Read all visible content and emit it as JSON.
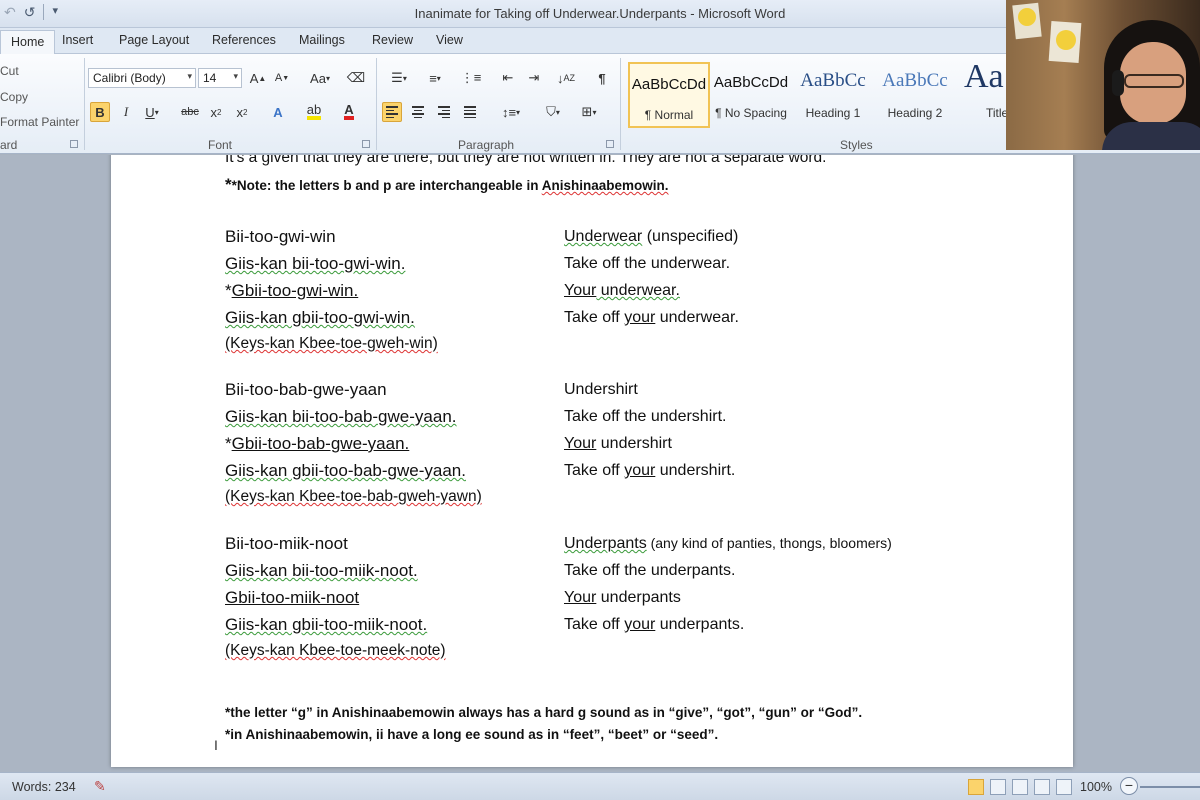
{
  "window": {
    "title": "Inanimate for Taking off Underwear.Underpants  -  Microsoft Word"
  },
  "tabs": [
    "Home",
    "Insert",
    "Page Layout",
    "References",
    "Mailings",
    "Review",
    "View"
  ],
  "ribbon": {
    "clipboard": {
      "items": [
        "Cut",
        "Copy",
        "Format Painter"
      ],
      "label": "ard"
    },
    "font": {
      "label": "Font",
      "font_name": "Calibri (Body)",
      "font_size": "14"
    },
    "paragraph": {
      "label": "Paragraph"
    },
    "styles": {
      "label": "Styles",
      "tiles": [
        {
          "sample": "AaBbCcDd",
          "name": "¶ Normal"
        },
        {
          "sample": "AaBbCcDd",
          "name": "¶ No Spacing"
        },
        {
          "sample": "AaBbCc",
          "name": "Heading 1"
        },
        {
          "sample": "AaBbCc",
          "name": "Heading 2"
        },
        {
          "sample": "Aa",
          "name": "Title"
        }
      ]
    }
  },
  "document": {
    "top_line": "It's a given that they are there, but they are not written in.  They are not a separate word.",
    "note_prefix": "*Note: the letters  b and p are interchangeable  in ",
    "note_word": "Anishinaabemowin.",
    "blocks": [
      {
        "rows": [
          {
            "left": "Bii-too-gwi-win",
            "right_u": "Underwear",
            "right_rest": "  (unspecified)"
          },
          {
            "left": "Giis-kan bii-too-gwi-win.",
            "right": "Take off the underwear."
          },
          {
            "left_star": "*",
            "left": "Gbii-too-gwi-win.",
            "right_u": "Your",
            "right_rest": " underwear."
          },
          {
            "left": "Giis-kan gbii-too-gwi-win.",
            "right_pre": "Take off ",
            "right_u": "your",
            "right_rest": " underwear."
          }
        ],
        "pronunciation": "(Keys-kan Kbee-toe-gweh-win)"
      },
      {
        "rows": [
          {
            "left": "Bii-too-bab-gwe-yaan",
            "right": "Undershirt"
          },
          {
            "left": "Giis-kan bii-too-bab-gwe-yaan.",
            "right": "Take off the undershirt."
          },
          {
            "left_star": "*",
            "left": "Gbii-too-bab-gwe-yaan.",
            "right_u": "Your",
            "right_rest": " undershirt"
          },
          {
            "left": "Giis-kan gbii-too-bab-gwe-yaan.",
            "right_pre": "Take off ",
            "right_u": "your",
            "right_rest": " undershirt."
          }
        ],
        "pronunciation": "(Keys-kan Kbee-toe-bab-gweh-yawn)"
      },
      {
        "rows": [
          {
            "left": "Bii-too-miik-noot",
            "right_u": "Underpants",
            "right_rest": "  (any kind of panties, thongs, bloomers)"
          },
          {
            "left": "Giis-kan bii-too-miik-noot.",
            "right": "Take off the underpants."
          },
          {
            "left": "Gbii-too-miik-noot",
            "right_u": "Your",
            "right_rest": " underpants"
          },
          {
            "left": "Giis-kan gbii-too-miik-noot.",
            "right_pre": "Take off ",
            "right_u": "your",
            "right_rest": " underpants."
          }
        ],
        "pronunciation": "(Keys-kan Kbee-toe-meek-note)"
      }
    ],
    "footnote1": "*the letter “g” in Anishinaabemowin always has a hard g sound as in “give”, “got”, “gun” or “God”.",
    "footnote2": "*in Anishinaabemowin, ii have a long ee sound as in “feet”, “beet” or “seed”."
  },
  "status": {
    "words": "Words: 234",
    "zoom": "100%"
  },
  "colors": {
    "accent": "#fbd36b",
    "ribbon_bg": "#e5edf6",
    "doc_bg": "#abb5c3",
    "spell_squiggle": "#d33",
    "grammar_squiggle": "#3a9a3a"
  },
  "icons": [
    "save-icon",
    "undo-icon",
    "redo-icon",
    "customize-qat-icon",
    "bold-icon",
    "italic-icon",
    "underline-icon",
    "strikethrough-icon",
    "subscript-icon",
    "superscript-icon",
    "text-effects-icon",
    "highlight-icon",
    "font-color-icon",
    "grow-font-icon",
    "shrink-font-icon",
    "change-case-icon",
    "clear-formatting-icon",
    "bullets-icon",
    "numbering-icon",
    "multilevel-list-icon",
    "decrease-indent-icon",
    "increase-indent-icon",
    "sort-icon",
    "show-marks-icon",
    "align-left-icon",
    "center-icon",
    "align-right-icon",
    "justify-icon",
    "line-spacing-icon",
    "shading-icon",
    "borders-icon",
    "proofing-icon",
    "print-layout-icon",
    "full-screen-icon",
    "web-layout-icon",
    "outline-icon",
    "draft-icon",
    "zoom-out-icon"
  ]
}
